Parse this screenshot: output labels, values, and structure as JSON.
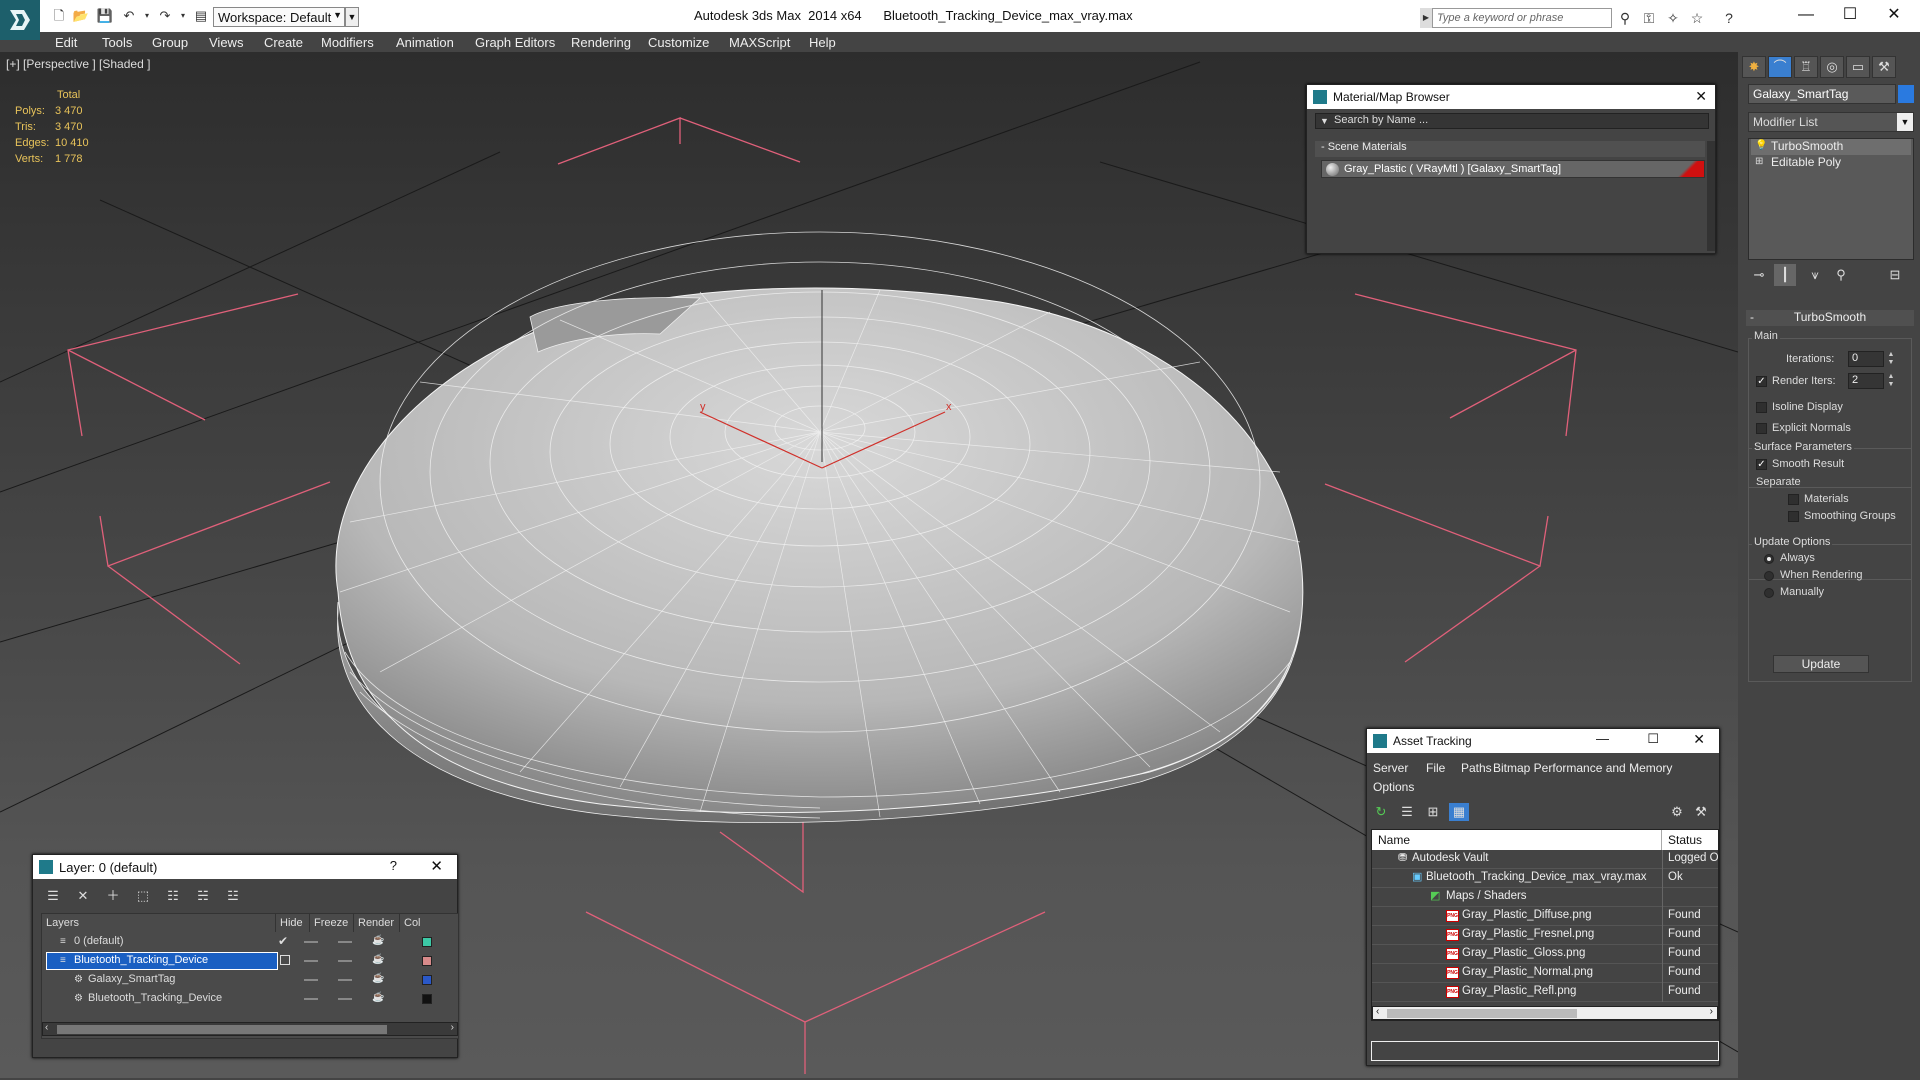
{
  "titlebar": {
    "workspace": "Workspace: Default",
    "app_title": "Autodesk 3ds Max  2014 x64",
    "file_title": "Bluetooth_Tracking_Device_max_vray.max",
    "search_placeholder": "Type a keyword or phrase"
  },
  "menu": [
    "Edit",
    "Tools",
    "Group",
    "Views",
    "Create",
    "Modifiers",
    "Animation",
    "Graph Editors",
    "Rendering",
    "Customize",
    "MAXScript",
    "Help"
  ],
  "viewport": {
    "label": "[+] [Perspective ] [Shaded ]",
    "stats": {
      "header": "Total",
      "polys_label": "Polys:",
      "polys": "3 470",
      "tris_label": "Tris:",
      "tris": "3 470",
      "edges_label": "Edges:",
      "edges": "10 410",
      "verts_label": "Verts:",
      "verts": "1 778"
    },
    "axis_x": "x",
    "axis_y": "y"
  },
  "command_panel": {
    "object_name": "Galaxy_SmartTag",
    "object_color": "#2a7ae0",
    "modifier_list": "Modifier List",
    "stack": [
      "TurboSmooth",
      "Editable Poly"
    ],
    "rollout_title": "TurboSmooth",
    "main_group": "Main",
    "iterations_label": "Iterations:",
    "iterations_value": "0",
    "render_iters_label": "Render Iters:",
    "render_iters_value": "2",
    "render_iters_checked": true,
    "isoline_label": "Isoline Display",
    "explicit_normals_label": "Explicit Normals",
    "surface_group": "Surface Parameters",
    "smooth_result_label": "Smooth Result",
    "separate_label": "Separate",
    "materials_label": "Materials",
    "smoothing_groups_label": "Smoothing Groups",
    "update_group": "Update Options",
    "always_label": "Always",
    "when_rendering_label": "When Rendering",
    "manually_label": "Manually",
    "update_button": "Update"
  },
  "material_browser": {
    "title": "Material/Map Browser",
    "search_placeholder": "Search by Name ...",
    "group": "- Scene Materials",
    "item": "Gray_Plastic  ( VRayMtl )  [Galaxy_SmartTag]"
  },
  "layer_dialog": {
    "title": "Layer: 0 (default)",
    "help": "?",
    "columns": [
      "Layers",
      "Hide",
      "Freeze",
      "Render",
      "Col"
    ],
    "rows": [
      {
        "name": "0 (default)",
        "color": "#3cc9a6",
        "checked": true
      },
      {
        "name": "Bluetooth_Tracking_Device",
        "color": "#d88a8a",
        "selected": true
      },
      {
        "name": "Galaxy_SmartTag",
        "color": "#2a58c8"
      },
      {
        "name": "Bluetooth_Tracking_Device",
        "color": "#111111"
      }
    ]
  },
  "asset_tracking": {
    "title": "Asset Tracking",
    "menu": [
      "Server",
      "File",
      "Paths",
      "Bitmap Performance and Memory",
      "Options"
    ],
    "columns": [
      "Name",
      "Status"
    ],
    "rows": [
      {
        "name": "Autodesk Vault",
        "status": "Logged O",
        "indent": 0
      },
      {
        "name": "Bluetooth_Tracking_Device_max_vray.max",
        "status": "Ok",
        "indent": 1
      },
      {
        "name": "Maps / Shaders",
        "status": "",
        "indent": 2
      },
      {
        "name": "Gray_Plastic_Diffuse.png",
        "status": "Found",
        "indent": 3
      },
      {
        "name": "Gray_Plastic_Fresnel.png",
        "status": "Found",
        "indent": 3
      },
      {
        "name": "Gray_Plastic_Gloss.png",
        "status": "Found",
        "indent": 3
      },
      {
        "name": "Gray_Plastic_Normal.png",
        "status": "Found",
        "indent": 3
      },
      {
        "name": "Gray_Plastic_Refl.png",
        "status": "Found",
        "indent": 3
      }
    ]
  }
}
